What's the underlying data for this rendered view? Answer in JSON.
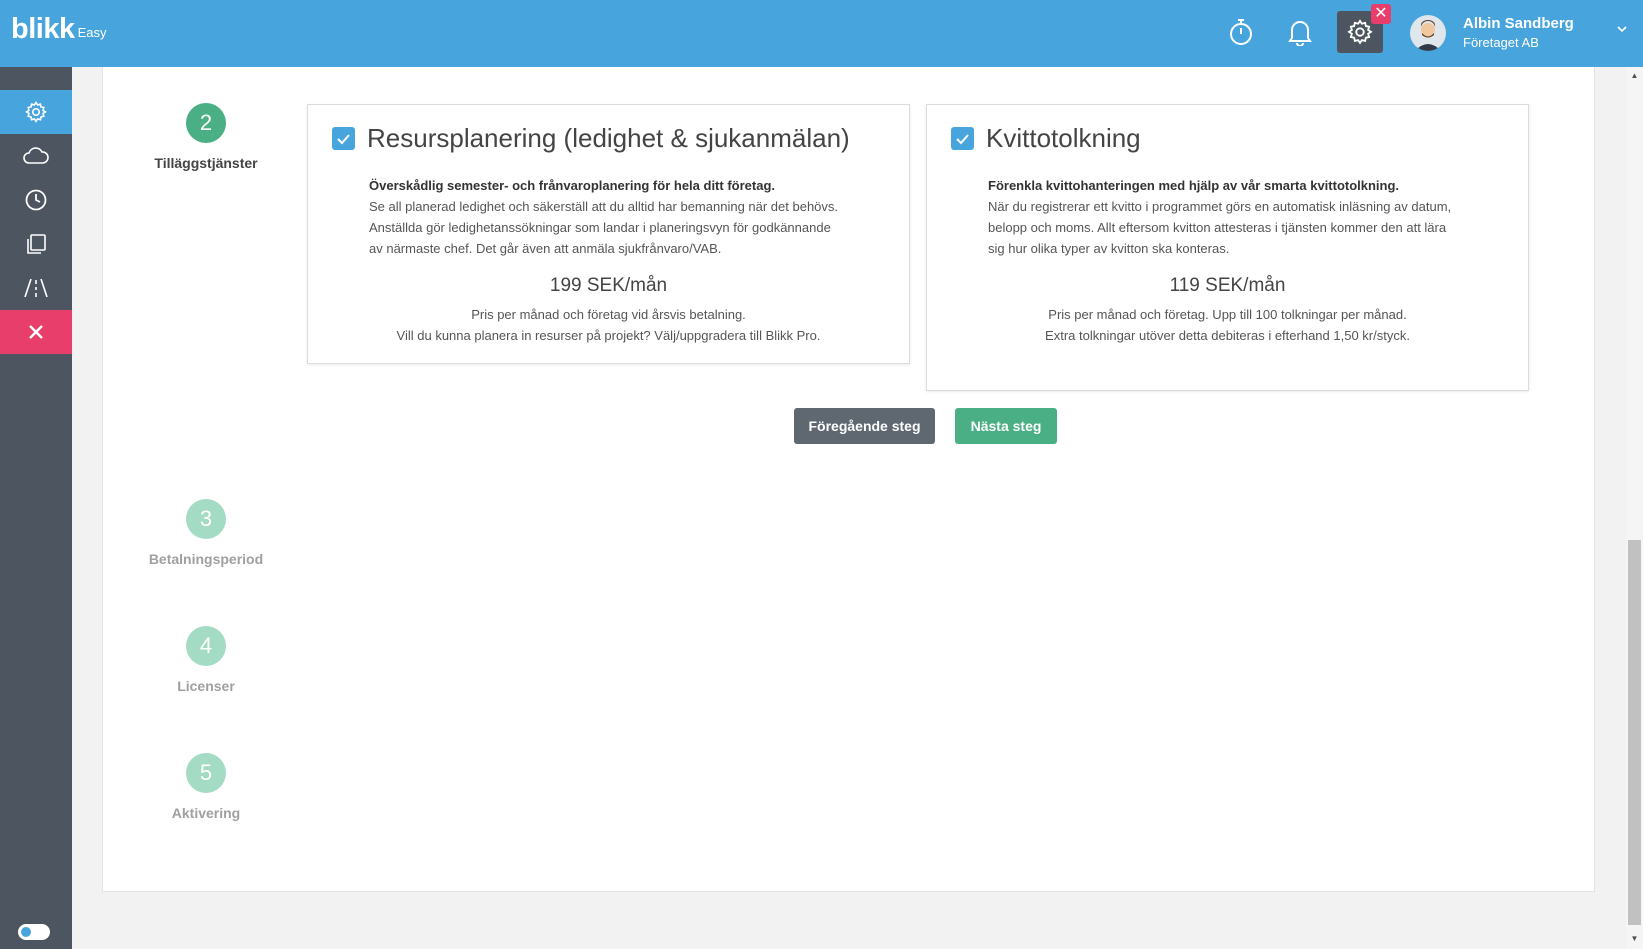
{
  "app": {
    "logo_text": "blikk",
    "logo_sub": "Easy"
  },
  "header": {
    "user_name": "Albin Sandberg",
    "user_company": "Företaget AB",
    "close_badge": "✕",
    "icons": [
      "stopwatch-icon",
      "bell-icon",
      "gear-icon",
      "close-icon",
      "avatar",
      "chevron-down-icon"
    ]
  },
  "sidebar": {
    "items": [
      {
        "icon": "gear-icon",
        "active": true
      },
      {
        "icon": "cloud-icon",
        "active": false
      },
      {
        "icon": "clock-icon",
        "active": false
      },
      {
        "icon": "copy-icon",
        "active": false
      },
      {
        "icon": "road-icon",
        "active": false
      },
      {
        "icon": "close-icon",
        "active": false
      }
    ],
    "toggle": "toggle-switch"
  },
  "steps": [
    {
      "number": "2",
      "label": "Tilläggstjänster",
      "active": true
    },
    {
      "number": "3",
      "label": "Betalningsperiod",
      "active": false
    },
    {
      "number": "4",
      "label": "Licenser",
      "active": false
    },
    {
      "number": "5",
      "label": "Aktivering",
      "active": false
    }
  ],
  "cards": [
    {
      "checked": true,
      "title": "Resursplanering (ledighet & sjukanmälan)",
      "lead": "Överskådlig semester- och frånvaroplanering för hela ditt företag.",
      "description": "Se all planerad ledighet och säkerställ att du alltid har bemanning när det behövs. Anställda gör ledighetanssökningar som landar i planeringsvyn för godkännande av närmaste chef. Det går även att anmäla sjukfrånvaro/VAB.",
      "price": "199 SEK/mån",
      "note_1": "Pris per månad och företag vid årsvis betalning.",
      "note_2": "Vill du kunna planera in resurser på projekt? Välj/uppgradera till Blikk Pro."
    },
    {
      "checked": true,
      "title": "Kvittotolkning",
      "lead": "Förenkla kvittohanteringen med hjälp av vår smarta kvittotolkning.",
      "description": "När du registrerar ett kvitto i programmet görs en automatisk inläsning av datum, belopp och moms. Allt eftersom kvitton attesteras i tjänsten kommer den att lära sig hur olika typer av kvitton ska konteras.",
      "price": "119 SEK/mån",
      "note_1": "Pris per månad och företag. Upp till 100 tolkningar per månad.",
      "note_2": "Extra tolkningar utöver detta debiteras i efterhand 1,50 kr/styck."
    }
  ],
  "buttons": {
    "prev": "Föregående steg",
    "next": "Nästa steg"
  },
  "colors": {
    "brand_blue": "#48a4dd",
    "sidebar": "#4c5560",
    "green": "#4aaf85",
    "pink": "#e83e6c"
  }
}
